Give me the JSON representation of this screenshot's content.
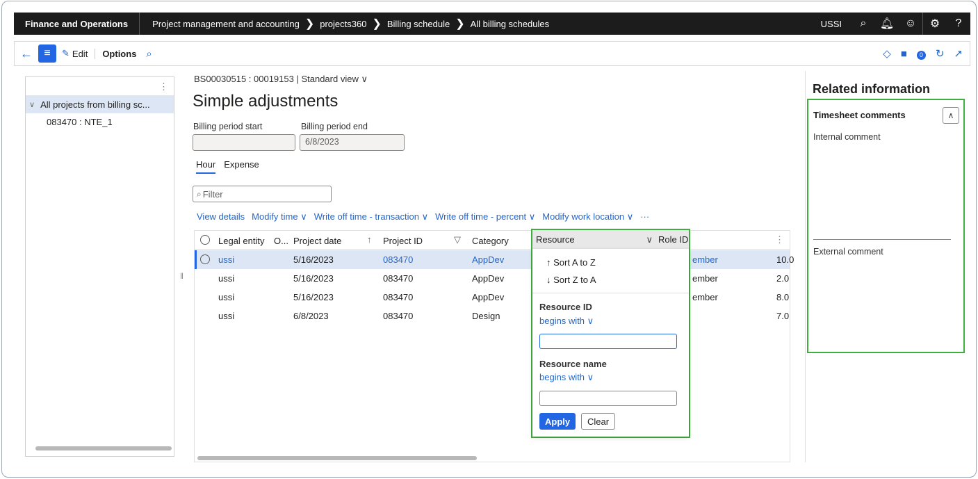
{
  "topbar": {
    "app_name": "Finance and Operations",
    "breadcrumbs": [
      "Project management and accounting",
      "projects360",
      "Billing schedule",
      "All billing schedules"
    ],
    "separator": ">",
    "company": "USSI"
  },
  "actionbar": {
    "edit_label": "Edit",
    "options_label": "Options",
    "badge_count": "0"
  },
  "leftpane": {
    "root_label": "All projects from billing sc...",
    "child_label": "083470 : NTE_1"
  },
  "main": {
    "record_line": "BS00030515 : 00019153  |  Standard view",
    "title": "Simple adjustments",
    "billing_start_label": "Billing period start",
    "billing_start_value": "",
    "billing_end_label": "Billing period end",
    "billing_end_value": "6/8/2023",
    "tabs": [
      "Hour",
      "Expense"
    ],
    "filter_placeholder": "Filter",
    "toolbar": [
      "View details",
      "Modify time",
      "Write off time - transaction",
      "Write off time - percent",
      "Modify work location",
      "···"
    ]
  },
  "grid": {
    "columns": [
      "Legal entity",
      "O...",
      "Project date",
      "Project ID",
      "Category",
      "Resource",
      "Role ID"
    ],
    "rows": [
      {
        "legal_entity": "ussi",
        "project_date": "5/16/2023",
        "project_id": "083470",
        "category": "AppDev",
        "role_tail": "ember",
        "qty_tail": "10.0"
      },
      {
        "legal_entity": "ussi",
        "project_date": "5/16/2023",
        "project_id": "083470",
        "category": "AppDev",
        "role_tail": "ember",
        "qty_tail": "2.0"
      },
      {
        "legal_entity": "ussi",
        "project_date": "5/16/2023",
        "project_id": "083470",
        "category": "AppDev",
        "role_tail": "ember",
        "qty_tail": "8.0"
      },
      {
        "legal_entity": "ussi",
        "project_date": "6/8/2023",
        "project_id": "083470",
        "category": "Design",
        "role_tail": "",
        "qty_tail": "7.0"
      }
    ]
  },
  "dropdown": {
    "header": "Resource",
    "role_header": "Role ID",
    "sort_az": "Sort A to Z",
    "sort_za": "Sort Z to A",
    "resource_id_label": "Resource ID",
    "resource_id_op": "begins with",
    "resource_name_label": "Resource name",
    "resource_name_op": "begins with",
    "apply": "Apply",
    "clear": "Clear"
  },
  "related": {
    "title": "Related information",
    "section": "Timesheet comments",
    "internal_label": "Internal comment",
    "external_label": "External comment"
  },
  "colors": {
    "accent": "#2266e3",
    "highlight_border": "#3fae3f",
    "selected_row": "#dce6f4"
  }
}
